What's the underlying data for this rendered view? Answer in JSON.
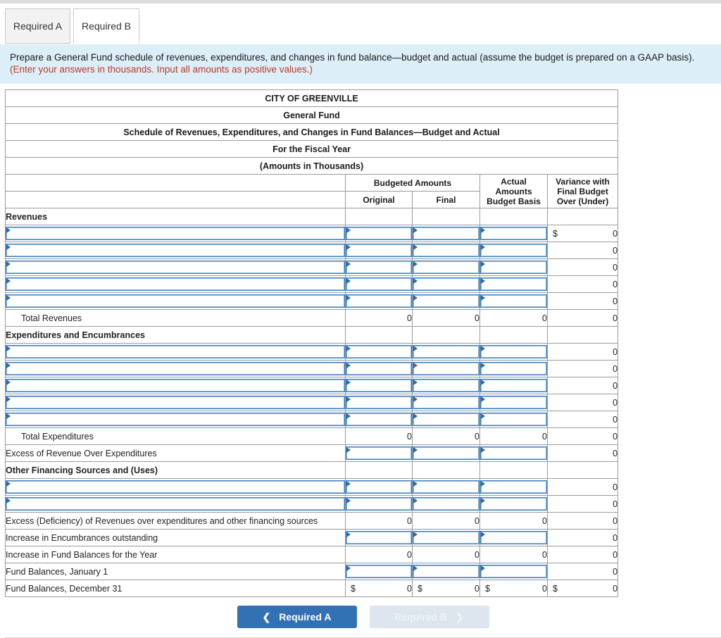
{
  "tabs": [
    {
      "label": "Required A",
      "active": false
    },
    {
      "label": "Required B",
      "active": true
    }
  ],
  "prompt": {
    "text": "Prepare a General Fund schedule of revenues, expenditures, and changes in fund balance—budget and actual (assume the budget is prepared on a GAAP basis). ",
    "note": "(Enter your answers in thousands. Input all amounts as positive values.)"
  },
  "sheet": {
    "title_lines": [
      "CITY OF GREENVILLE",
      "General Fund",
      "Schedule of Revenues, Expenditures, and Changes in Fund Balances—Budget and Actual",
      "For the Fiscal Year",
      "(Amounts in Thousands)"
    ],
    "column_headers": {
      "budgeted_group": "Budgeted Amounts",
      "original": "Original",
      "final": "Final",
      "actual_line1": "Actual",
      "actual_line2": "Amounts",
      "actual_line3": "Budget Basis",
      "variance_line1": "Variance with",
      "variance_line2": "Final Budget",
      "variance_line3": "Over (Under)"
    },
    "rows": [
      {
        "type": "section",
        "label": "Revenues"
      },
      {
        "type": "input",
        "label": "",
        "variance": "0",
        "variance_dollar": "$"
      },
      {
        "type": "input",
        "label": "",
        "variance": "0"
      },
      {
        "type": "input",
        "label": "",
        "variance": "0"
      },
      {
        "type": "input",
        "label": "",
        "variance": "0"
      },
      {
        "type": "input",
        "label": "",
        "variance": "0"
      },
      {
        "type": "total",
        "label": "Total Revenues",
        "indent": true,
        "original": "0",
        "final": "0",
        "actual": "0",
        "variance": "0"
      },
      {
        "type": "section",
        "label": "Expenditures and Encumbrances"
      },
      {
        "type": "input",
        "label": "",
        "variance": "0"
      },
      {
        "type": "input",
        "label": "",
        "variance": "0"
      },
      {
        "type": "input",
        "label": "",
        "variance": "0"
      },
      {
        "type": "input",
        "label": "",
        "variance": "0"
      },
      {
        "type": "input",
        "label": "",
        "variance": "0"
      },
      {
        "type": "total",
        "label": "Total Expenditures",
        "indent": true,
        "original": "0",
        "final": "0",
        "actual": "0",
        "variance": "0"
      },
      {
        "type": "input_labeled",
        "label": "Excess of Revenue Over Expenditures",
        "variance": "0",
        "topline": true
      },
      {
        "type": "section",
        "label": "Other Financing Sources and (Uses)"
      },
      {
        "type": "input",
        "label": "",
        "variance": "0"
      },
      {
        "type": "input",
        "label": "",
        "variance": "0"
      },
      {
        "type": "total",
        "label": "Excess (Deficiency) of Revenues over expenditures and other financing sources",
        "original": "0",
        "final": "0",
        "actual": "0",
        "variance": "0",
        "topline": true
      },
      {
        "type": "input_labeled",
        "label": "Increase in Encumbrances outstanding",
        "variance": "0"
      },
      {
        "type": "total",
        "label": "Increase in Fund Balances for the Year",
        "original": "0",
        "final": "0",
        "actual": "0",
        "variance": "0"
      },
      {
        "type": "input_labeled",
        "label": "Fund Balances, January 1",
        "variance": "0"
      },
      {
        "type": "grand",
        "label": "Fund Balances, December 31",
        "original": "0",
        "final": "0",
        "actual": "0",
        "variance": "0",
        "dollar": "$"
      }
    ]
  },
  "footer": {
    "prev_label": "Required A",
    "next_label": "Required B",
    "prev_icon": "chevron-left-icon",
    "next_icon": "chevron-right-icon"
  },
  "colors": {
    "header_blue": "#77aade",
    "prompt_blue": "#dceef7",
    "note_red": "#c0392b",
    "primary_button": "#3272b4",
    "muted_button": "#dde6ef",
    "input_border": "#3d7ebf"
  }
}
